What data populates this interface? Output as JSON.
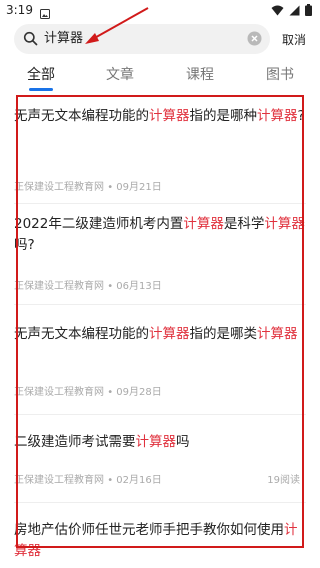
{
  "status": {
    "time": "3:19"
  },
  "search": {
    "query": "计算器",
    "cancel_label": "取消"
  },
  "tabs": [
    {
      "label": "全部",
      "active": true
    },
    {
      "label": "文章",
      "active": false
    },
    {
      "label": "课程",
      "active": false
    },
    {
      "label": "图书",
      "active": false
    }
  ],
  "results": [
    {
      "title_parts": [
        "无声无文本编程功能的",
        "计算器",
        "指的是哪种",
        "计算器",
        "?"
      ],
      "source": "正保建设工程教育网",
      "date": "09月21日",
      "views": ""
    },
    {
      "title_parts": [
        "2022年二级建造师机考内置",
        "计算器",
        "是科学",
        "计算器",
        "吗?"
      ],
      "source": "正保建设工程教育网",
      "date": "06月13日",
      "views": ""
    },
    {
      "title_parts": [
        "无声无文本编程功能的",
        "计算器",
        "指的是哪类",
        "计算器",
        ""
      ],
      "source": "正保建设工程教育网",
      "date": "09月28日",
      "views": ""
    },
    {
      "title_parts": [
        "二级建造师考试需要",
        "计算器",
        "吗"
      ],
      "source": "正保建设工程教育网",
      "date": "02月16日",
      "views": "19阅读"
    },
    {
      "title_parts": [
        "房地产估价师任世元老师手把手教你如何使用",
        "计算器",
        ""
      ],
      "source": "",
      "date": "",
      "views": ""
    }
  ],
  "meta_separator": "•",
  "colors": {
    "highlight": "#e0323e",
    "accent": "#1a73e8",
    "annotation": "#d11a1a"
  }
}
